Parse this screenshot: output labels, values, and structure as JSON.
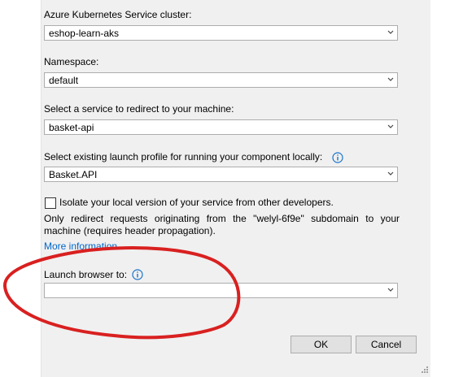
{
  "cluster": {
    "label": "Azure Kubernetes Service cluster:",
    "value": "eshop-learn-aks",
    "icon": "chevron-down-icon"
  },
  "namespace": {
    "label": "Namespace:",
    "value": "default",
    "icon": "chevron-down-icon"
  },
  "service": {
    "label": "Select a service to redirect to your machine:",
    "value": "basket-api",
    "icon": "chevron-down-icon"
  },
  "launch_profile": {
    "label": "Select existing launch profile for running your component locally:",
    "value": "Basket.API",
    "info_icon": "info-icon"
  },
  "isolate": {
    "checkbox_label": "Isolate your local version of your service from other developers.",
    "checked": false,
    "description": "Only redirect requests originating from the \"welyl-6f9e\" subdomain to your machine (requires header propagation).",
    "more_info_link": "More information"
  },
  "launch_browser": {
    "label": "Launch browser to:",
    "value": "",
    "info_icon": "info-icon"
  },
  "buttons": {
    "ok": "OK",
    "cancel": "Cancel"
  },
  "colors": {
    "dialog_bg": "#f0f0f0",
    "link": "#0066cc",
    "info_icon": "#1a73c9",
    "annotation": "#d92020"
  }
}
